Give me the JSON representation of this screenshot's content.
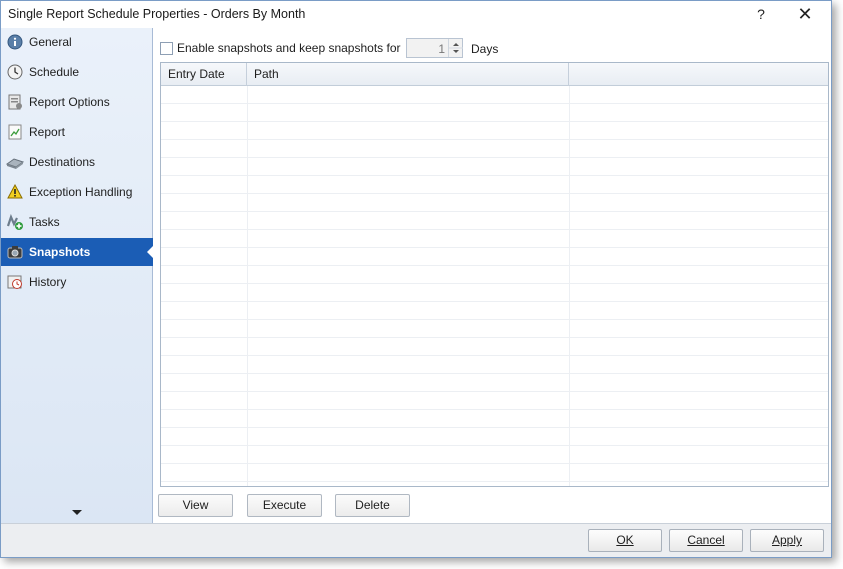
{
  "window": {
    "title": "Single Report Schedule Properties - Orders By Month",
    "help_label": "?",
    "close_label": "✕"
  },
  "sidebar": {
    "items": [
      {
        "label": "General",
        "icon": "info-icon"
      },
      {
        "label": "Schedule",
        "icon": "clock-icon"
      },
      {
        "label": "Report Options",
        "icon": "report-options-icon"
      },
      {
        "label": "Report",
        "icon": "report-icon"
      },
      {
        "label": "Destinations",
        "icon": "destinations-icon"
      },
      {
        "label": "Exception Handling",
        "icon": "warning-icon"
      },
      {
        "label": "Tasks",
        "icon": "tasks-icon"
      },
      {
        "label": "Snapshots",
        "icon": "camera-icon",
        "active": true
      },
      {
        "label": "History",
        "icon": "history-icon"
      }
    ],
    "active_color": "#1b5db5"
  },
  "snapshots": {
    "enable_label": "Enable snapshots and keep snapshots for",
    "enabled": false,
    "days_value": "1",
    "days_label": "Days",
    "columns": [
      "Entry Date",
      "Path",
      ""
    ],
    "rows": [],
    "buttons": {
      "view": "View",
      "execute": "Execute",
      "delete": "Delete"
    }
  },
  "footer": {
    "ok": "OK",
    "cancel": "Cancel",
    "apply": "Apply"
  }
}
